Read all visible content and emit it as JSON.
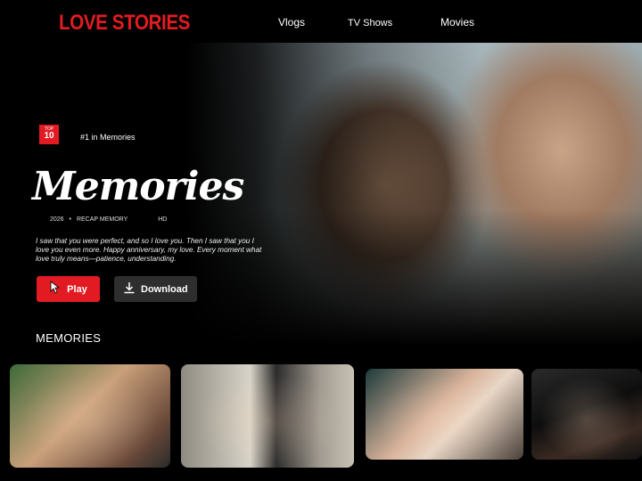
{
  "brand": "LOVE STORIES",
  "nav": {
    "vlogs": "Vlogs",
    "tv_shows": "TV Shows",
    "movies": "Movies"
  },
  "hero": {
    "badge_top": "TOP",
    "badge_num": "10",
    "rank_text": "#1 in Memories",
    "title": "Memories",
    "year": "2026",
    "bullet": "•",
    "category": "RECAP MEMORY",
    "quality": "HD",
    "description": "I saw that you were perfect, and so I love you. Then I saw that you I love you even more. Happy anniversary, my love. Every moment what love truly means—patience, understanding.",
    "play_label": "Play",
    "download_label": "Download"
  },
  "section": {
    "title": "MEMORIES"
  },
  "thumbnails": [
    "couple-selfie-garden",
    "couple-mirror-selfie-elevator",
    "friend-laughing-hands",
    "couple-night-city"
  ],
  "colors": {
    "accent": "#e21b23",
    "background": "#000000",
    "download_bg": "#2e2e2e"
  },
  "icons": {
    "play": "cursor-hand-icon",
    "download": "download-icon"
  }
}
